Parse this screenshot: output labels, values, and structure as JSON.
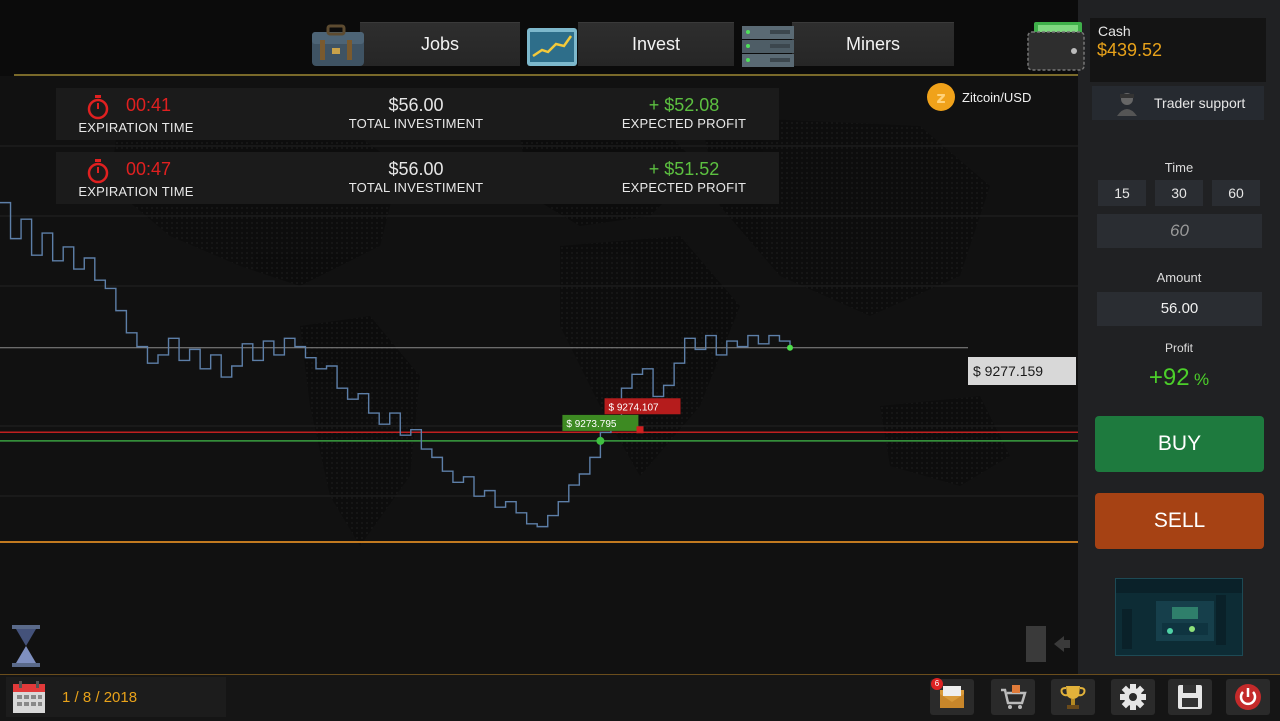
{
  "nav": {
    "jobs": "Jobs",
    "invest": "Invest",
    "miners": "Miners"
  },
  "wallet": {
    "label": "Cash",
    "amount": "$439.52"
  },
  "pair": "Zitcoin/USD",
  "investments": [
    {
      "time": "00:41",
      "time_label": "EXPIRATION TIME",
      "total": "$56.00",
      "total_label": "TOTAL INVESTIMENT",
      "profit": "+ $52.08",
      "profit_label": "EXPECTED PROFIT"
    },
    {
      "time": "00:47",
      "time_label": "EXPIRATION TIME",
      "total": "$56.00",
      "total_label": "TOTAL INVESTIMENT",
      "profit": "+ $51.52",
      "profit_label": "EXPECTED PROFIT"
    }
  ],
  "chart_data": {
    "type": "line",
    "series": [
      {
        "values": [
          9282.4,
          9281.1,
          9281.8,
          9280.5,
          9281.3,
          9280.3,
          9280.8,
          9280.0,
          9280.4,
          9279.6,
          9279.3,
          9278.5,
          9277.7,
          9277.2,
          9276.6,
          9276.9,
          9277.5,
          9276.7,
          9277.1,
          9276.4,
          9276.9,
          9276.1,
          9276.5,
          9277.3,
          9276.7,
          9277.4,
          9276.9,
          9277.5,
          9277.2,
          9276.8,
          9276.4,
          9276.5,
          9275.7,
          9275.3,
          9275.5,
          9274.8,
          9274.4,
          9274.8,
          9274.0,
          9274.2,
          9273.5,
          9273.2,
          9272.7,
          9272.3,
          9272.5,
          9271.8,
          9272.0,
          9271.4,
          9271.6,
          9271.2,
          9270.8,
          9270.7,
          9271.1,
          9271.6,
          9272.2,
          9272.6,
          9273.2,
          9274.1,
          9274.5,
          9275.7,
          9276.2,
          9276.4,
          9275.4,
          9275.8,
          9276.6,
          9277.5,
          9277.1,
          9277.6,
          9276.9,
          9277.4,
          9277.2,
          9277.6,
          9277.3,
          9277.6,
          9277.4,
          9277.16
        ]
      }
    ],
    "current_price": "$ 9277.159",
    "current_value": 9277.159,
    "buy_marker": {
      "label": "$ 9273.795",
      "value": 9273.795
    },
    "sell_marker": {
      "label": "$ 9274.107",
      "value": 9274.107
    }
  },
  "panel": {
    "trader_support": "Trader support",
    "time_label": "Time",
    "time_options": [
      "15",
      "30",
      "60"
    ],
    "time_value": "60",
    "amount_label": "Amount",
    "amount_value": "56.00",
    "profit_label": "Profit",
    "profit_value": "+92",
    "profit_unit": "%",
    "buy": "BUY",
    "sell": "SELL"
  },
  "date": "1 / 8 / 2018",
  "notifications": {
    "mail_count": "6"
  },
  "colors": {
    "buy": "#1e7a3e",
    "sell": "#a64214",
    "cash": "#e8a21a",
    "loss": "#e02020",
    "gain": "#5cc040"
  }
}
